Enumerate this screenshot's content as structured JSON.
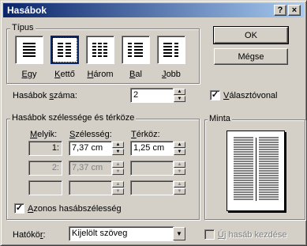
{
  "window": {
    "title": "Hasábok",
    "help_label": "?",
    "close_label": "×"
  },
  "presets": {
    "group_label": "Típus",
    "items": [
      {
        "label": "Egy",
        "hotkey": "E",
        "rest": "gy"
      },
      {
        "label": "Kettő",
        "hotkey": "K",
        "rest": "ettő"
      },
      {
        "label": "Három",
        "hotkey": "H",
        "rest": "árom"
      },
      {
        "label": "Bal",
        "hotkey": "B",
        "rest": "al"
      },
      {
        "label": "Jobb",
        "hotkey": "J",
        "rest": "obb"
      }
    ]
  },
  "buttons": {
    "ok": "OK",
    "cancel": "Mégse"
  },
  "columns_count": {
    "label_prefix": "Hasábok ",
    "label_hotkey": "s",
    "label_suffix": "záma:",
    "value": "2"
  },
  "line_between": {
    "label_prefix": "",
    "label_hotkey": "V",
    "label_suffix": "álasztóvonal",
    "checked": true
  },
  "width_spacing": {
    "group_label": "Hasábok szélessége és térköze",
    "header_col": {
      "hotkey": "M",
      "rest": "elyik:"
    },
    "header_width": {
      "hotkey": "S",
      "rest": "zélesség:"
    },
    "header_spacing": {
      "hotkey": "T",
      "rest": "érköz:"
    },
    "rows": [
      {
        "col": "1:",
        "width": "7,37 cm",
        "spacing": "1,25 cm",
        "enabled": true
      },
      {
        "col": "2:",
        "width": "7,37 cm",
        "spacing": "",
        "enabled": false
      },
      {
        "col": "",
        "width": "",
        "spacing": "",
        "enabled": false
      }
    ]
  },
  "equal_width": {
    "label_prefix": "",
    "label_hotkey": "A",
    "label_suffix": "zonos hasábszélesség",
    "checked": true
  },
  "preview": {
    "group_label": "Minta"
  },
  "apply_to": {
    "label_prefix": "Hatókö",
    "label_hotkey": "r",
    "label_suffix": ":",
    "value": "Kijelölt szöveg"
  },
  "new_column": {
    "label_prefix": "",
    "label_hotkey": "Ú",
    "label_suffix": "j hasáb kezdése",
    "checked": false
  }
}
